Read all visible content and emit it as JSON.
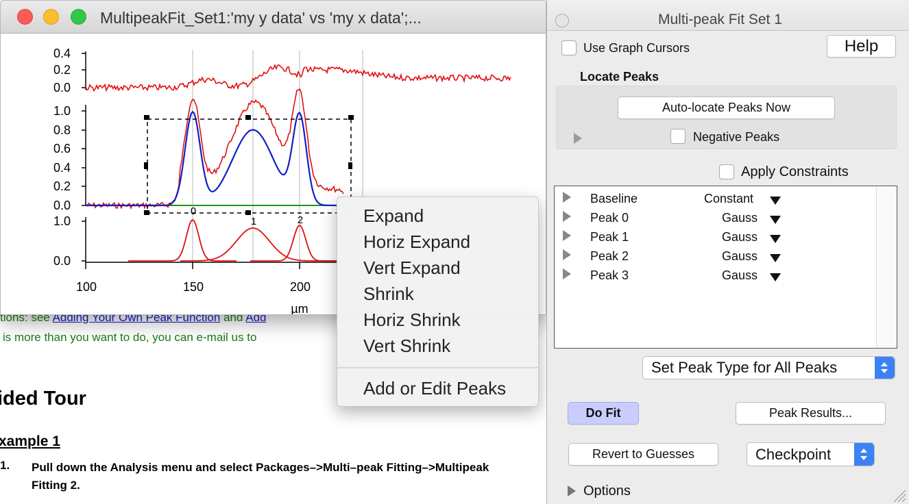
{
  "doc": {
    "fragment_1": "tions: see",
    "link_1": "Adding Your Own Peak Function",
    "fragment_2": "and",
    "link_2": "Add",
    "line_2": "is more than you want to do, you can e-mail us to",
    "section_title": "ided Tour",
    "example_title": "xample 1",
    "step_number": "1.",
    "step_1": "Pull down the Analysis menu and select Packages–>Multi–peak Fitting–>Multipeak Fitting 2."
  },
  "graph_window": {
    "title": "MultipeakFit_Set1:'my y data' vs 'my x data';...",
    "x_axis_label": "µm",
    "x_ticks": [
      "100",
      "150",
      "200"
    ],
    "residual_ticks": [
      "0.4",
      "0.2",
      "0.0"
    ],
    "main_ticks": [
      "1.0",
      "0.8",
      "0.6",
      "0.4",
      "0.2",
      "0.0"
    ],
    "peaks_ticks": [
      "1.0",
      "0.0"
    ],
    "peak_labels": [
      "0",
      "1",
      "2"
    ],
    "colors": {
      "data": "#e01010",
      "fit": "#1020c0",
      "baseline": "#1a9a1a"
    }
  },
  "context_menu": {
    "items": [
      "Expand",
      "Horiz Expand",
      "Vert Expand",
      "Shrink",
      "Horiz Shrink",
      "Vert Shrink"
    ],
    "extra_item": "Add or Edit Peaks"
  },
  "panel": {
    "title": "Multi-peak Fit Set 1",
    "use_graph_cursors": "Use Graph Cursors",
    "help": "Help",
    "locate_peaks_heading": "Locate Peaks",
    "auto_locate": "Auto-locate Peaks Now",
    "negative_peaks": "Negative Peaks",
    "apply_constraints": "Apply Constraints",
    "peak_list": [
      {
        "name": "Baseline",
        "type": "Constant"
      },
      {
        "name": "Peak 0",
        "type": "Gauss"
      },
      {
        "name": "Peak 1",
        "type": "Gauss"
      },
      {
        "name": "Peak 2",
        "type": "Gauss"
      },
      {
        "name": "Peak 3",
        "type": "Gauss"
      }
    ],
    "set_peak_type": "Set Peak Type for All Peaks",
    "do_fit": "Do Fit",
    "peak_results": "Peak Results...",
    "revert": "Revert to Guesses",
    "checkpoint": "Checkpoint",
    "options": "Options"
  }
}
